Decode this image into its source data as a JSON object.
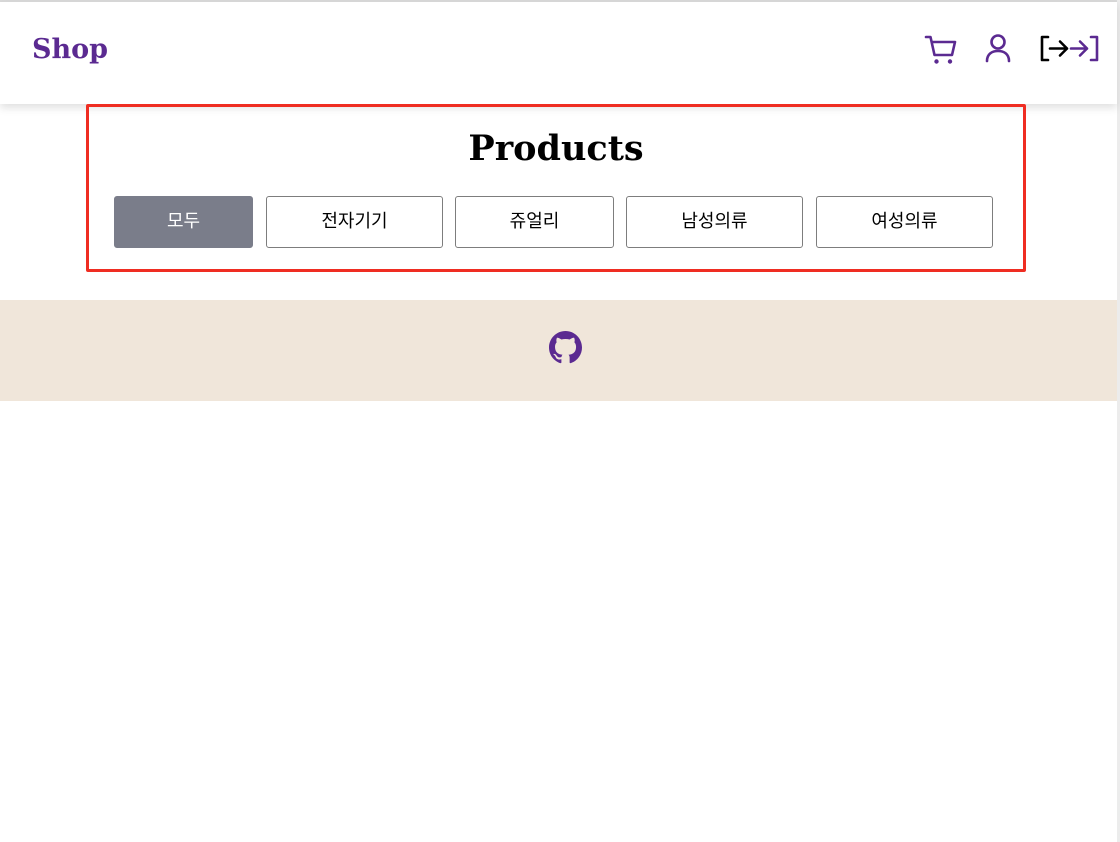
{
  "header": {
    "brand": "Shop",
    "nav_icons": [
      "cart-icon",
      "user-icon",
      "login-icon"
    ]
  },
  "products": {
    "title": "Products",
    "filters": [
      {
        "label": "모두",
        "active": true
      },
      {
        "label": "전자기기",
        "active": false
      },
      {
        "label": "쥬얼리",
        "active": false
      },
      {
        "label": "남성의류",
        "active": false
      },
      {
        "label": "여성의류",
        "active": false
      }
    ]
  },
  "footer": {
    "icon": "github-icon"
  },
  "colors": {
    "brand": "#5b2a91",
    "highlight_border": "#ef2d22",
    "active_filter_bg": "#7a7d8a",
    "footer_bg": "#f0e6da"
  }
}
